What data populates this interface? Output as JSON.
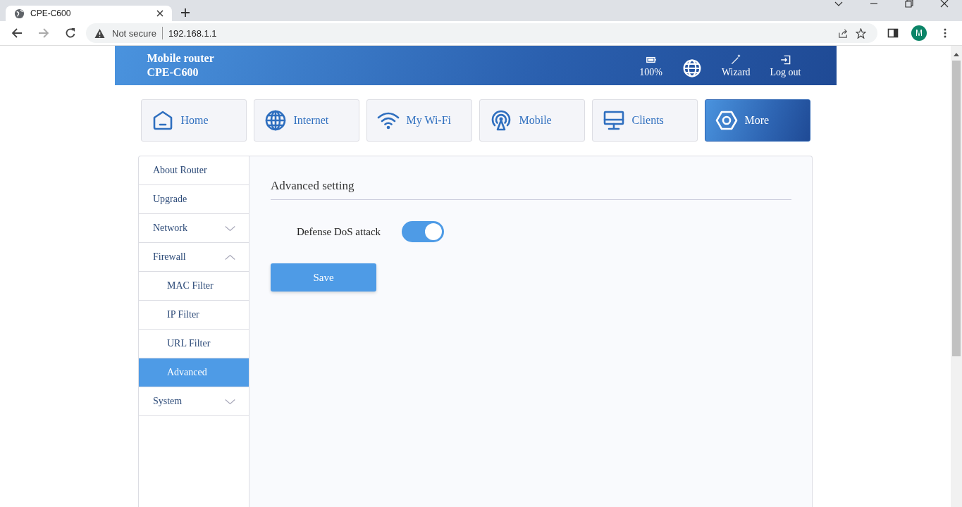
{
  "browser": {
    "tab_title": "CPE-C600",
    "security": "Not secure",
    "url": "192.168.1.1",
    "profile": "M"
  },
  "header": {
    "brand": [
      "Mobile router",
      "CPE-C600"
    ],
    "status": [
      {
        "kind": "battery",
        "label": "100%"
      },
      {
        "kind": "globe"
      },
      {
        "kind": "wizard",
        "label": "Wizard"
      },
      {
        "kind": "logout",
        "label": "Log out"
      }
    ]
  },
  "nav_tabs": [
    {
      "kind": "home",
      "label": "Home",
      "selected": false
    },
    {
      "kind": "internet",
      "label": "Internet",
      "selected": false
    },
    {
      "kind": "wifi",
      "label": "My Wi-Fi",
      "selected": false
    },
    {
      "kind": "mobile",
      "label": "Mobile",
      "selected": false
    },
    {
      "kind": "clients",
      "label": "Clients",
      "selected": false
    },
    {
      "kind": "more",
      "label": "More",
      "selected": true
    }
  ],
  "sidebar": {
    "items": [
      {
        "label": "About Router",
        "selected": false
      },
      {
        "label": "Upgrade",
        "selected": false
      },
      {
        "label": "Network",
        "selected": false,
        "expanded": false
      },
      {
        "label": "Firewall",
        "selected": false,
        "expanded": true,
        "children": [
          {
            "label": "MAC Filter",
            "selected": false
          },
          {
            "label": "IP Filter",
            "selected": false
          },
          {
            "label": "URL Filter",
            "selected": false
          },
          {
            "label": "Advanced",
            "selected": true
          }
        ]
      },
      {
        "label": "System",
        "selected": false,
        "expanded": false
      }
    ]
  },
  "content": {
    "title": "Advanced setting",
    "settings": [
      {
        "label": "Defense DoS attack",
        "on": true
      }
    ],
    "save_button": "Save"
  }
}
